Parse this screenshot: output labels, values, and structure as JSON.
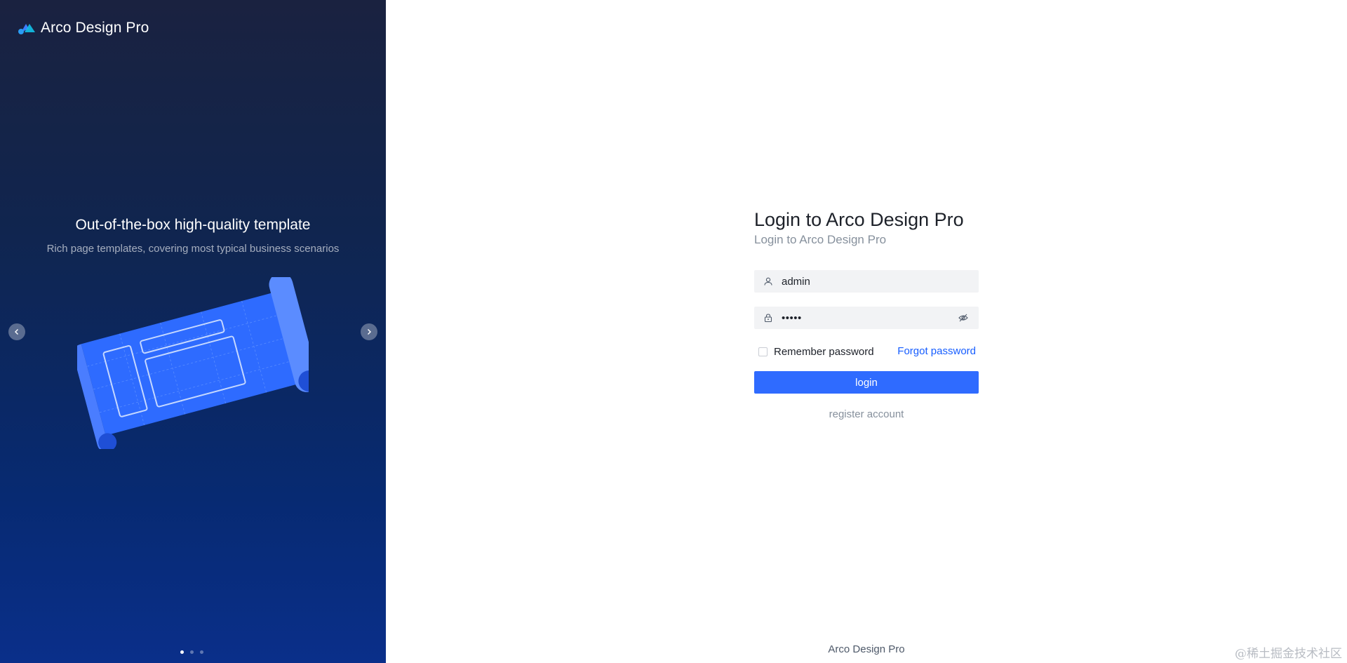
{
  "brand": {
    "name": "Arco Design Pro",
    "icon": "arco-logo-icon"
  },
  "carousel": {
    "title": "Out-of-the-box high-quality template",
    "subtitle": "Rich page templates, covering most typical business scenarios",
    "prev_icon": "chevron-left-icon",
    "next_icon": "chevron-right-icon",
    "dot_count": 3,
    "active_index": 0
  },
  "login": {
    "title": "Login to Arco Design Pro",
    "subtitle": "Login to Arco Design Pro",
    "username": {
      "value": "admin",
      "icon": "user-icon"
    },
    "password": {
      "masked": "•••••",
      "icon": "lock-icon",
      "toggle_icon": "eye-off-icon"
    },
    "remember_label": "Remember password",
    "remember_checked": false,
    "forgot_label": "Forgot password",
    "login_button": "login",
    "register_label": "register account"
  },
  "footer": {
    "text": "Arco Design Pro"
  },
  "watermark": {
    "text": "@稀土掘金技术社区"
  },
  "colors": {
    "primary": "#2f6bff",
    "link": "#165dff",
    "banner_top": "#1a2240",
    "banner_bottom": "#0a2f8a"
  }
}
